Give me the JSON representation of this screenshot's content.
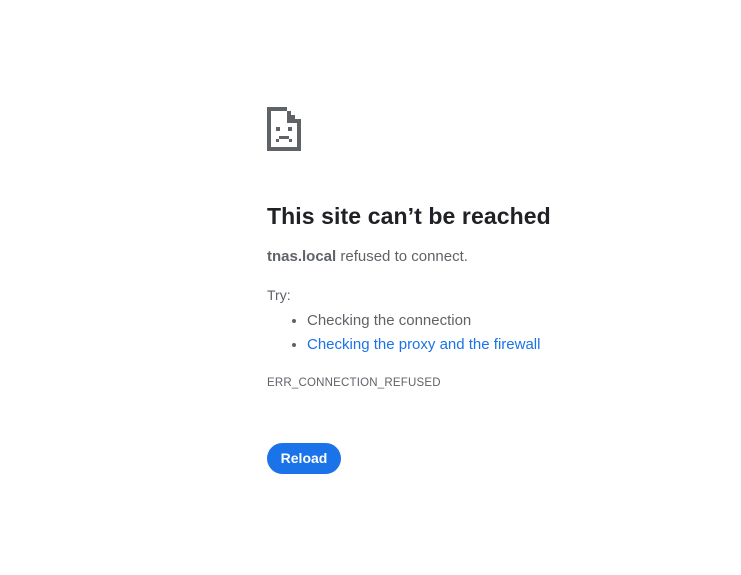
{
  "error_page": {
    "icon": "sad-page-icon",
    "title": "This site can’t be reached",
    "host": "tnas.local",
    "detail_suffix": " refused to connect.",
    "try_label": "Try:",
    "suggestions": [
      {
        "text": "Checking the connection",
        "is_link": false
      },
      {
        "text": "Checking the proxy and the firewall",
        "is_link": true
      }
    ],
    "error_code": "ERR_CONNECTION_REFUSED",
    "reload_label": "Reload"
  },
  "colors": {
    "accent": "#1a73e8",
    "title_text": "#202124",
    "secondary_text": "#5f6368",
    "icon": "#5f6368"
  }
}
